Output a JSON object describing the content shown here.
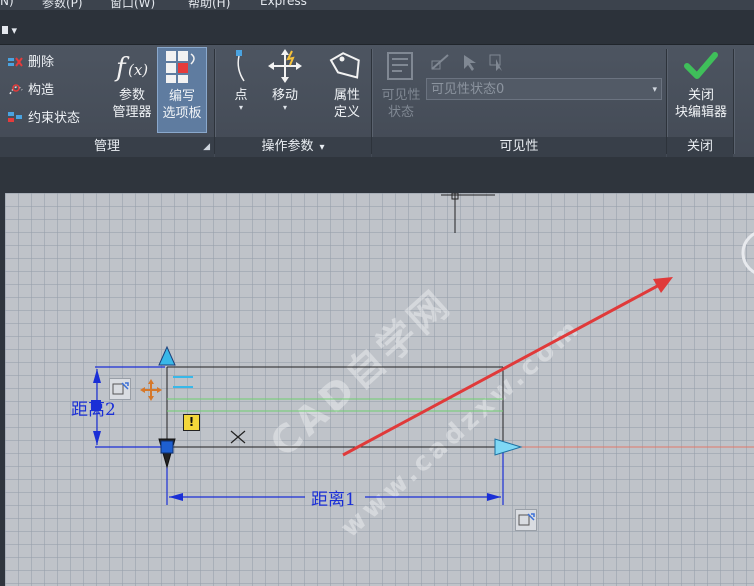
{
  "menu": {
    "items": [
      "N)",
      "参数(P)",
      "窗口(W)",
      "帮助(H)",
      "Express"
    ]
  },
  "quick_access": {
    "caret": "▾"
  },
  "ribbon": {
    "manage_panel": {
      "title": "管理",
      "items": [
        {
          "label": "删除",
          "icon": "delete-icon"
        },
        {
          "label": "构造",
          "icon": "construct-icon"
        },
        {
          "label": "约束状态",
          "icon": "constraint-status-icon"
        }
      ],
      "param_manager": {
        "line1": "参数",
        "line2": "管理器",
        "icon": "fx-icon"
      },
      "write_palette": {
        "line1": "编写",
        "line2": "选项板",
        "icon": "palette-icon"
      }
    },
    "action_params_panel": {
      "title": "操作参数",
      "title_caret": "▾",
      "point": {
        "label": "点",
        "icon": "point-param-icon",
        "caret": "▾"
      },
      "move": {
        "label": "移动",
        "icon": "move-icon",
        "caret": "▾"
      },
      "attr_def": {
        "line1": "属性",
        "line2": "定义",
        "icon": "attribute-tag-icon"
      }
    },
    "visibility_panel": {
      "title": "可见性",
      "vis_state": {
        "line1": "可见性",
        "line2": "状态",
        "icon": "visibility-state-icon"
      },
      "select_value": "可见性状态0",
      "select_caret": "▾"
    },
    "close_panel": {
      "title": "关闭",
      "close_button": {
        "line1": "关闭",
        "line2": "块编辑器",
        "icon": "checkmark-icon"
      }
    }
  },
  "drawing": {
    "dimension_1": "距离1",
    "dimension_2": "距离2",
    "watermark_1": "CAD自学网",
    "watermark_2": "www.cadzxw.com"
  },
  "colors": {
    "accent_red_arrow": "#e03a3a",
    "dimension_blue": "#1a2fd6",
    "grip_cyan": "#39b8e8",
    "check_green": "#3fbf5a"
  }
}
